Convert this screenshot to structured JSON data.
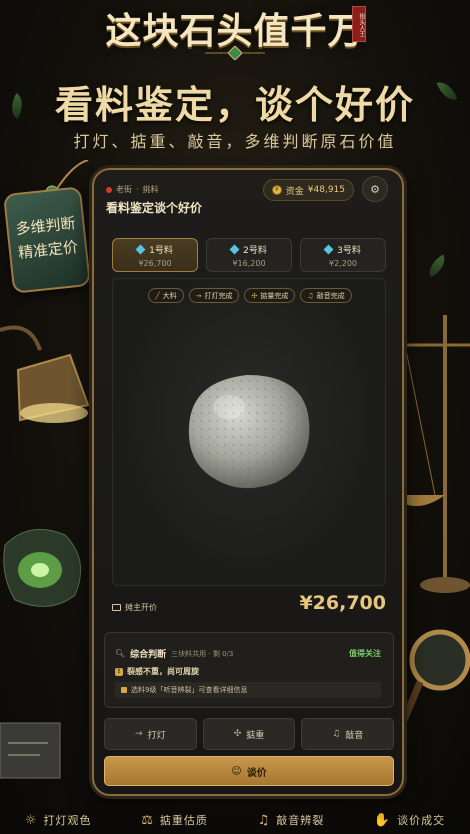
{
  "header": {
    "game_title": "这块石头值千万",
    "seal_text": "街头人王",
    "headline": "看料鉴定，谈个好价",
    "subline": "打灯、掂重、敲音，多维判断原石价值"
  },
  "hang_tag": {
    "line1": "多维判断",
    "line2": "精准定价"
  },
  "panel": {
    "location": {
      "area": "老街",
      "separator": "·",
      "mode": "挑料"
    },
    "stage_title": "看料鉴定谈个好价",
    "funds": {
      "icon": "coin-icon",
      "label": "资金",
      "value": "¥48,915"
    },
    "settings_icon": "gear-icon",
    "stones": [
      {
        "name": "1号料",
        "price": "¥26,700",
        "active": true
      },
      {
        "name": "2号料",
        "price": "¥16,200",
        "active": false
      },
      {
        "name": "3号料",
        "price": "¥2,200",
        "active": false
      }
    ],
    "chips": [
      {
        "icon": "knife-icon",
        "label": "大料"
      },
      {
        "icon": "light-icon",
        "label": "打灯完成"
      },
      {
        "icon": "weight-icon",
        "label": "掂量完成"
      },
      {
        "icon": "bell-icon",
        "label": "敲音完成"
      }
    ],
    "price": {
      "label": "摊主开价",
      "value": "¥26,700"
    },
    "judgement": {
      "title": "综合判断",
      "subtitle": "三块料共用 · 剩 0/3",
      "status": "值得关注",
      "finding": "裂感不重，尚可周旋",
      "hint": "选料9级「听音辨裂」可查看详细信息"
    },
    "actions": [
      {
        "icon": "light-icon",
        "label": "打灯"
      },
      {
        "icon": "weight-icon",
        "label": "掂重"
      },
      {
        "icon": "bell-icon",
        "label": "敲音"
      }
    ],
    "bargain": {
      "icon": "handshake-icon",
      "label": "谈价"
    }
  },
  "steps": [
    {
      "icon": "lamp-icon",
      "label": "打灯观色"
    },
    {
      "icon": "weight-icon",
      "label": "掂重估质"
    },
    {
      "icon": "bell-icon",
      "label": "敲音辨裂"
    },
    {
      "icon": "bargain-icon",
      "label": "谈价成交"
    }
  ],
  "colors": {
    "accent_gold": "#e6c77d",
    "status_green": "#7fc86a",
    "button_gold": "#c8974a",
    "frame": "#8a6d3b"
  }
}
